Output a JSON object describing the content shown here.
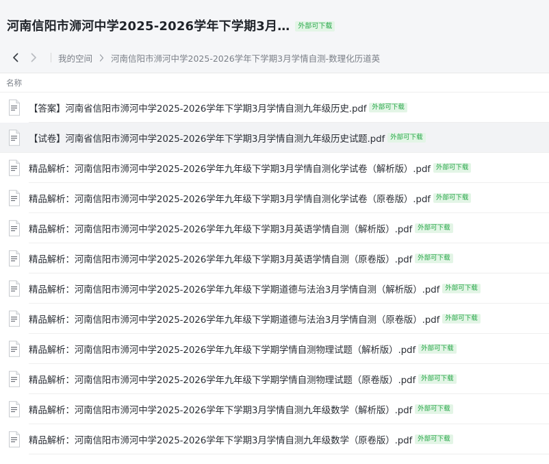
{
  "header": {
    "title": "河南信阳市浉河中学2025-2026学年下学期3月…",
    "badge": "外部可下载"
  },
  "breadcrumb": {
    "back_icon": "chevron-left-icon",
    "forward_icon": "chevron-right-icon",
    "root": "我的空间",
    "current": "河南信阳市浉河中学2025-2026学年下学期3月学情自测-数理化历道英"
  },
  "columns": {
    "name": "名称"
  },
  "files": [
    {
      "name": "【答案】河南省信阳市浉河中学2025-2026学年下学期3月学情自测九年级历史.pdf",
      "badge": "外部可下载"
    },
    {
      "name": "【试卷】河南省信阳市浉河中学2025-2026学年下学期3月学情自测九年级历史试题.pdf",
      "badge": "外部可下载"
    },
    {
      "name": "精品解析：河南信阳市浉河中学2025-2026学年九年级下学期3月学情自测化学试卷（解析版）.pdf",
      "badge": "外部可下载"
    },
    {
      "name": "精品解析：河南信阳市浉河中学2025-2026学年九年级下学期3月学情自测化学试卷（原卷版）.pdf",
      "badge": "外部可下载"
    },
    {
      "name": "精品解析：河南信阳市浉河中学2025-2026学年九年级下学期3月英语学情自测（解析版）.pdf",
      "badge": "外部可下载"
    },
    {
      "name": "精品解析：河南信阳市浉河中学2025-2026学年九年级下学期3月英语学情自测（原卷版）.pdf",
      "badge": "外部可下载"
    },
    {
      "name": "精品解析：河南信阳市浉河中学2025-2026学年九年级下学期道德与法治3月学情自测（解析版）.pdf",
      "badge": "外部可下载"
    },
    {
      "name": "精品解析：河南信阳市浉河中学2025-2026学年九年级下学期道德与法治3月学情自测（原卷版）.pdf",
      "badge": "外部可下载"
    },
    {
      "name": "精品解析：河南信阳市浉河中学2025-2026学年九年级下学期学情自测物理试题（解析版）.pdf",
      "badge": "外部可下载"
    },
    {
      "name": "精品解析：河南信阳市浉河中学2025-2026学年九年级下学期学情自测物理试题（原卷版）.pdf",
      "badge": "外部可下载"
    },
    {
      "name": "精品解析：河南信阳市浉河中学2025-2026学年下学期3月学情自测九年级数学（解析版）.pdf",
      "badge": "外部可下载"
    },
    {
      "name": "精品解析：河南信阳市浉河中学2025-2026学年下学期3月学情自测九年级数学（原卷版）.pdf",
      "badge": "外部可下载"
    }
  ],
  "file_icon": "pdf-file-icon",
  "colors": {
    "badge_bg": "#e3f5e6",
    "badge_text": "#29a84a",
    "selected_row": "#f2f3f5"
  }
}
